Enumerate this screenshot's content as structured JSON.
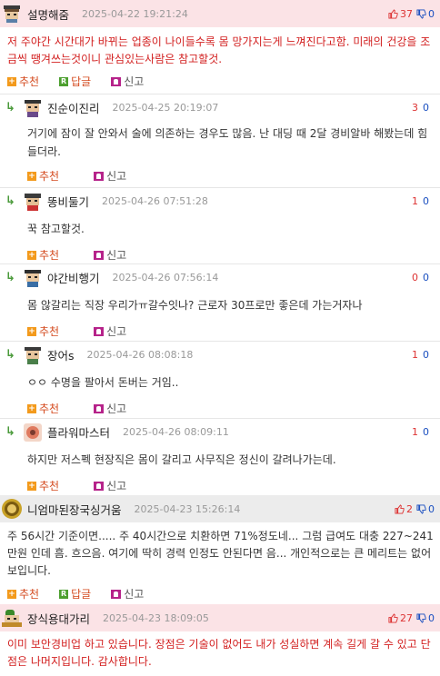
{
  "comments": [
    {
      "nick": "설명해줌",
      "date": "2025-04-22 19:21:24",
      "up": "37",
      "down": "0",
      "body": "저 주야간 시간대가 바뀌는 업종이 나이들수록 몸 망가지는게 느껴진다고함. 미래의 건강을 조금씩 땡겨쓰는것이니 관심있는사람은 참고할것.",
      "actions": {
        "recommend": "추천",
        "reply": "답글",
        "report": "신고"
      },
      "replies": [
        {
          "nick": "진순이진리",
          "date": "2025-04-25 20:19:07",
          "up": "3",
          "down": "0",
          "body": "거기에 잠이 잘 안와서 술에 의존하는 경우도 많음. 난 대딩 때 2달 경비알바 해봤는데 힘들더라.",
          "recommend": "추천",
          "report": "신고"
        },
        {
          "nick": "똥비둘기",
          "date": "2025-04-26 07:51:28",
          "up": "1",
          "down": "0",
          "body": "꾹 참고할것.",
          "recommend": "추천",
          "report": "신고"
        },
        {
          "nick": "야간비행기",
          "date": "2025-04-26 07:56:14",
          "up": "0",
          "down": "0",
          "body": "몸 않갈리는 직장 우리가ㅠ갈수잇나? 근로자 30프로만 좋은데 가는거자나",
          "recommend": "추천",
          "report": "신고"
        },
        {
          "nick": "장어s",
          "date": "2025-04-26 08:08:18",
          "up": "1",
          "down": "0",
          "body": "ㅇㅇ 수명을 팔아서 돈버는 거임..",
          "recommend": "추천",
          "report": "신고"
        },
        {
          "nick": "플라워마스터",
          "date": "2025-04-26 08:09:11",
          "up": "1",
          "down": "0",
          "body": "하지만 저스펙 현장직은 몸이 갈리고 사무직은 정신이 갈려나가는데.",
          "recommend": "추천",
          "report": "신고"
        }
      ]
    },
    {
      "nick": "니엄마된장국싱거움",
      "date": "2025-04-23 15:26:14",
      "up": "2",
      "down": "0",
      "body": "주 56시간 기준이면..... 주 40시간으로 치환하면 71%정도네... 그럼 급여도 대충 227~241만원 인데 흠. 흐으음. 여기에 딱히 경력 인정도 안된다면 음... 개인적으로는 큰 메리트는 없어보입니다.",
      "actions": {
        "recommend": "추천",
        "reply": "답글",
        "report": "신고"
      }
    },
    {
      "nick": "장식용대가리",
      "date": "2025-04-23 18:09:05",
      "up": "27",
      "down": "0",
      "body": "이미 보안경비업 하고 있습니다. 장점은 기술이 없어도 내가 성실하면 계속 길게 갈 수 있고 단점은 나머지입니다. 감사합니다."
    }
  ],
  "colors": {
    "pink_header": "#fbe3e6",
    "gray_header": "#ececec",
    "up": "#d33333",
    "down": "#1a4fc0",
    "red_text": "#d21e1e",
    "reply_arrow": "#4a9a3a"
  },
  "icons": {
    "thumb_up": "thumb-up-icon",
    "thumb_down": "thumb-down-icon",
    "recommend": "plus-icon",
    "reply": "r-icon",
    "report": "siren-icon",
    "reply_arrow": "reply-arrow-icon"
  }
}
